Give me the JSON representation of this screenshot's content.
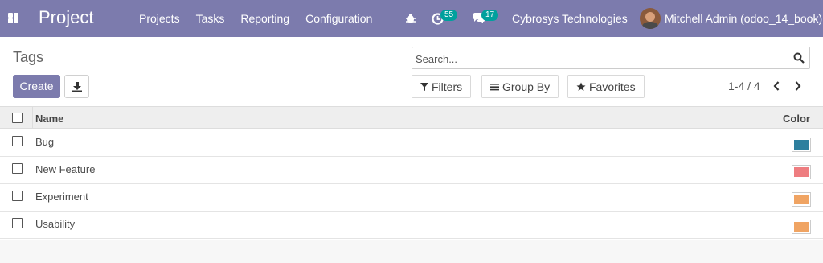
{
  "navbar": {
    "brand": "Project",
    "menu": [
      "Projects",
      "Tasks",
      "Reporting",
      "Configuration"
    ],
    "activity_count": "55",
    "message_count": "17",
    "company": "Cybrosys Technologies",
    "user": "Mitchell Admin (odoo_14_book)",
    "accent_color": "#7c7bad",
    "badge_color": "#00a09d"
  },
  "control_panel": {
    "title": "Tags",
    "create_label": "Create",
    "search_placeholder": "Search...",
    "filters_label": "Filters",
    "group_by_label": "Group By",
    "favorites_label": "Favorites",
    "pager": "1-4 / 4"
  },
  "table": {
    "headers": {
      "name": "Name",
      "color": "Color"
    },
    "rows": [
      {
        "name": "Bug",
        "color": "#2e7f9e"
      },
      {
        "name": "New Feature",
        "color": "#ee7d80"
      },
      {
        "name": "Experiment",
        "color": "#f0a463"
      },
      {
        "name": "Usability",
        "color": "#f0a463"
      }
    ]
  }
}
